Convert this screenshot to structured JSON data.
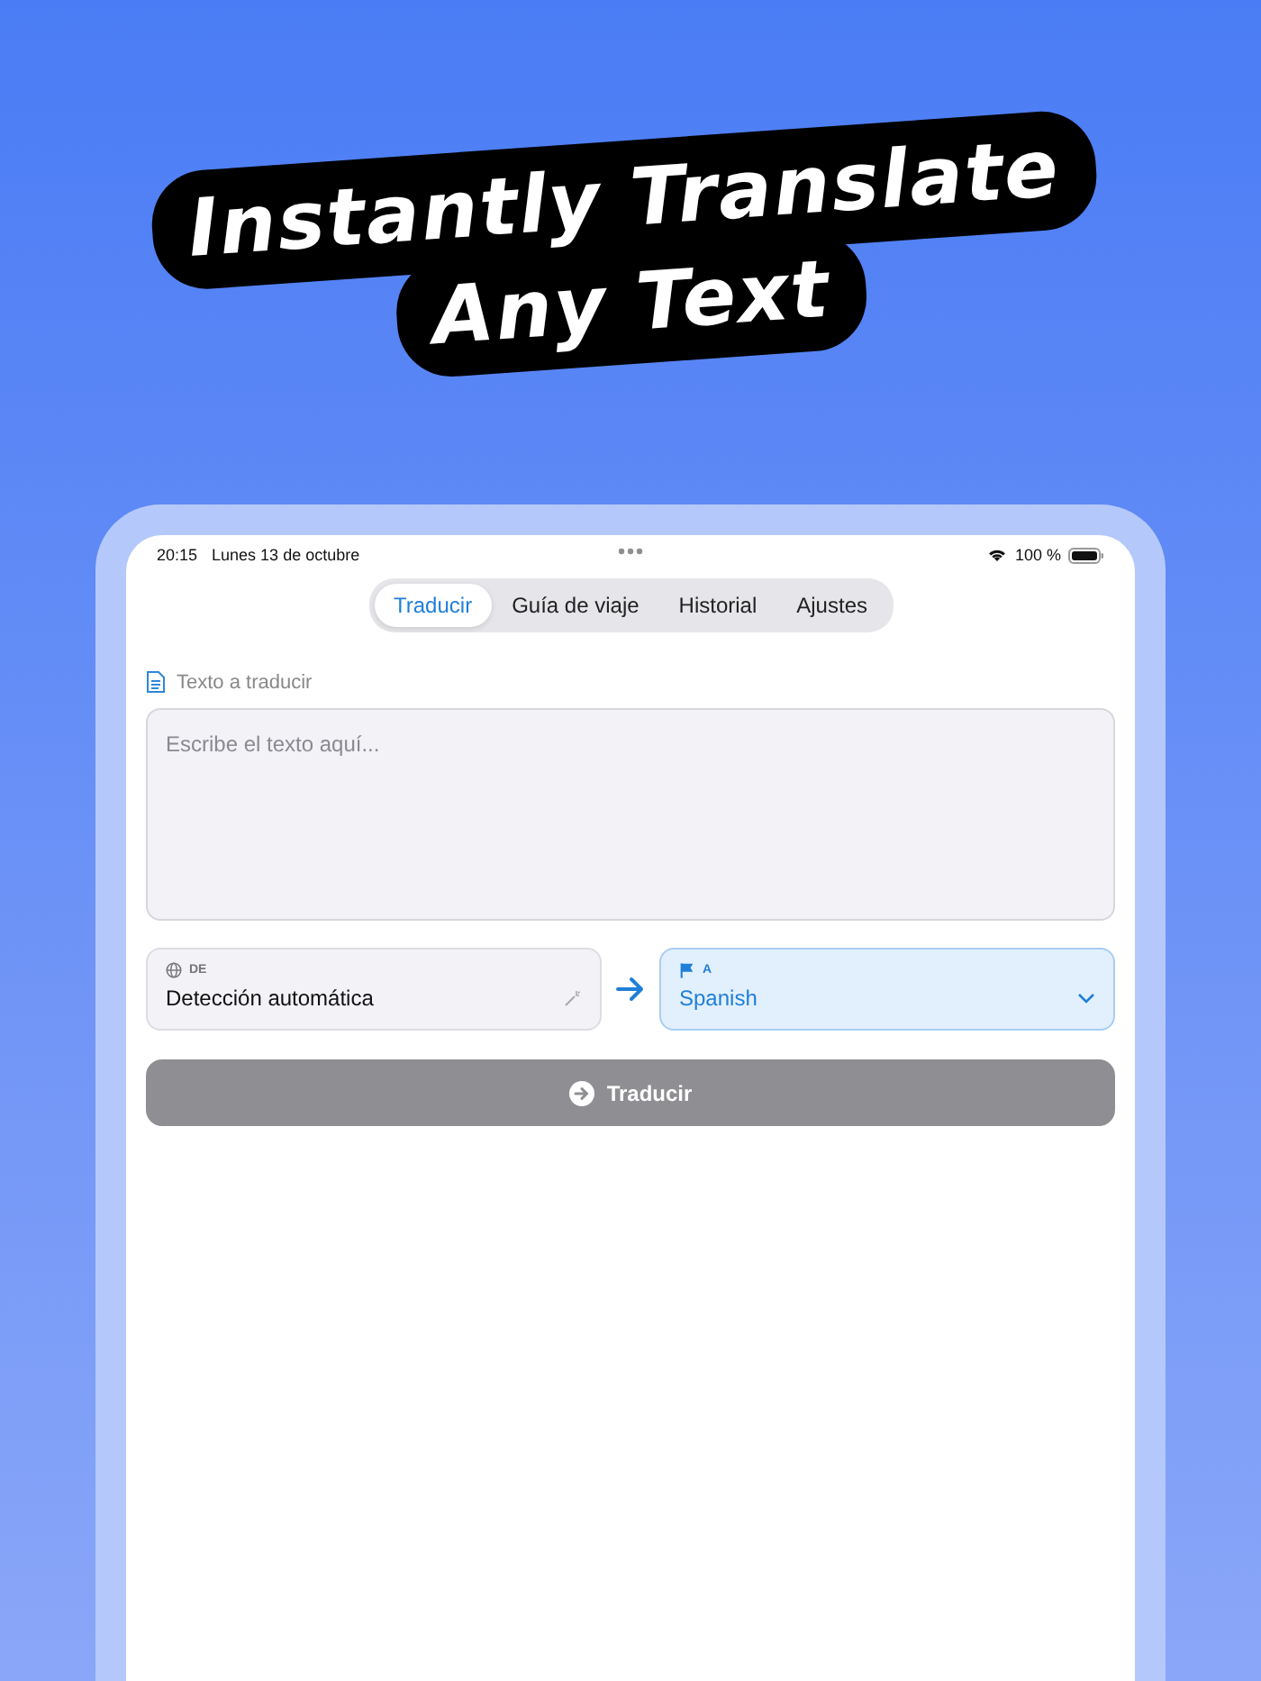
{
  "headline": {
    "lines": [
      "Instantly Translate",
      "Any Text"
    ]
  },
  "status_bar": {
    "time": "20:15",
    "date": "Lunes 13 de octubre",
    "battery": "100 %"
  },
  "tabs": [
    {
      "label": "Traducir",
      "selected": true
    },
    {
      "label": "Guía de viaje",
      "selected": false
    },
    {
      "label": "Historial",
      "selected": false
    },
    {
      "label": "Ajustes",
      "selected": false
    }
  ],
  "input": {
    "label": "Texto a traducir",
    "placeholder": "Escribe el texto aquí..."
  },
  "source_language": {
    "label": "DE",
    "value": "Detección automática",
    "selected": false
  },
  "target_language": {
    "label": "A",
    "value": "Spanish",
    "selected": true
  },
  "translate_button": {
    "label": "Traducir",
    "disabled": true
  }
}
